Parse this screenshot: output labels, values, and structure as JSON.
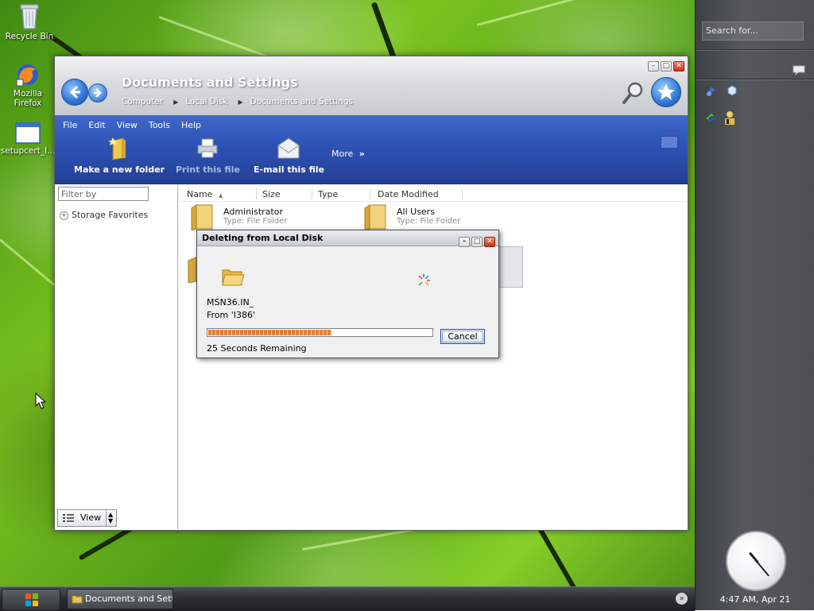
{
  "desktop": {
    "icons": [
      {
        "label": "Recycle Bin",
        "icon": "recycle-bin-icon"
      },
      {
        "label": "Mozilla Firefox",
        "icon": "firefox-icon"
      },
      {
        "label": "setupcert_I...",
        "icon": "window-app-icon"
      }
    ]
  },
  "sidebar": {
    "search_placeholder": "Search for...",
    "clock_time": "4:47 AM, Apr 21"
  },
  "taskbar": {
    "task_label": "Documents and Sett..."
  },
  "explorer": {
    "title": "Documents and Settings",
    "breadcrumb": [
      "Computer",
      "Local Disk",
      "Documents and Settings"
    ],
    "menu": [
      "File",
      "Edit",
      "View",
      "Tools",
      "Help"
    ],
    "toolbar": {
      "new_folder": "Make a new folder",
      "print": "Print this file",
      "email": "E-mail this file",
      "more": "More"
    },
    "left_pane": {
      "filter_placeholder": "Filter by",
      "storage_favorites": "Storage Favorites",
      "view_label": "View"
    },
    "columns": [
      "Name",
      "Size",
      "Type",
      "Date Modified"
    ],
    "items": [
      {
        "name": "Administrator",
        "type": "Type: File Folder"
      },
      {
        "name": "All Users",
        "type": "Type: File Folder"
      }
    ]
  },
  "dialog": {
    "title": "Deleting from Local Disk",
    "file_name": "MSN36.IN_",
    "from": "From 'I386'",
    "progress": 0.55,
    "remaining": "25 Seconds Remaining",
    "cancel_label": "Cancel"
  }
}
